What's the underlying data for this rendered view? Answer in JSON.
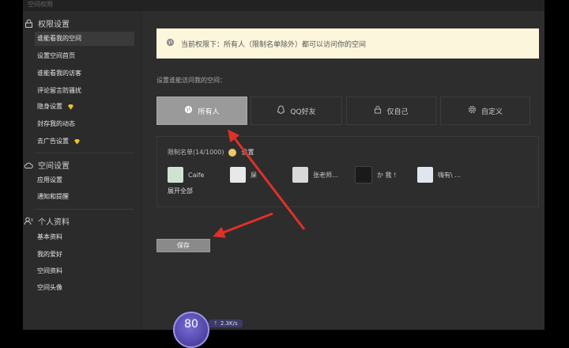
{
  "window": {
    "title": "空间权限"
  },
  "sidebar": {
    "groups": [
      {
        "title": "权限设置",
        "icon": "lock-icon"
      },
      {
        "title": "空间设置",
        "icon": "cloud-icon"
      },
      {
        "title": "个人资料",
        "icon": "person-icon"
      }
    ],
    "perm_items": [
      "谁能看我的空间",
      "设置空间首页",
      "谁能看我的访客",
      "评论留言防骚扰",
      "隐身设置",
      "封存我的动态",
      "去广告设置"
    ],
    "space_items": [
      "应用设置",
      "通知和提醒"
    ],
    "profile_items": [
      "基本资料",
      "我的爱好",
      "空间资料",
      "空间头像"
    ]
  },
  "notice": {
    "text": "当前权限下：所有人（限制名单除外）都可以访问你的空间"
  },
  "section_label": "设置谁能访问我的空间：",
  "options": [
    {
      "label": "所有人",
      "icon": "globe-icon",
      "selected": true
    },
    {
      "label": "QQ好友",
      "icon": "qq-icon",
      "selected": false
    },
    {
      "label": "仅自己",
      "icon": "lock-icon",
      "selected": false
    },
    {
      "label": "自定义",
      "icon": "gear-icon",
      "selected": false
    }
  ],
  "restrict": {
    "label": "限制名单(14/1000)",
    "set_label": "设置"
  },
  "friends": [
    {
      "name": "Caife",
      "color": "#cfe3d4"
    },
    {
      "name": "屎",
      "color": "#e8e8e8"
    },
    {
      "name": "张老师…",
      "color": "#d8d8d8"
    },
    {
      "name": "か 我 !",
      "color": "#1a1a1a"
    },
    {
      "name": "嗨有\\ …",
      "color": "#dfe6f0"
    }
  ],
  "expand_label": "展开全部",
  "save_label": "保存",
  "widget": {
    "score": "80",
    "speed": "2.3K/s"
  },
  "colors": {
    "arrow": "#e0302a",
    "notice_bg": "#fcf6dc",
    "diamond": "#f1c21b"
  }
}
